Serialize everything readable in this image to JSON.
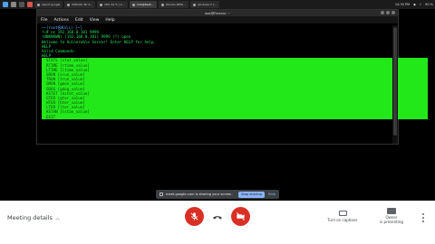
{
  "taskbar": {
    "menu_icon_color": "#4ea1ff",
    "tabs": [
      "",
      "",
      "",
      "",
      "report google",
      "Miktotik 3D A...",
      "CPU 34 % | 2...",
      "root@Kaali...",
      "Ubuntu MPTo...",
      "windows 7 [..."
    ],
    "status": [
      "14:30 PM",
      "",
      "",
      "90 %"
    ]
  },
  "terminal": {
    "title": "root@Freenix: ~",
    "menu": [
      "File",
      "Actions",
      "Edit",
      "View",
      "Help"
    ],
    "lines_before": [
      {
        "text": "──(root㉿Kali)-[~]",
        "blue": true
      },
      {
        "text": "└─# nc 192.168.0.101 9999",
        "blue": false
      },
      {
        "text": "(UNKNOWN) [192.168.0.101] 9999 (?) open",
        "blue": false
      },
      {
        "text": "Welcome to Vulnerable Server! Enter HELP for help.",
        "blue": false
      },
      {
        "text": "HELP",
        "blue": false
      },
      {
        "text": "Valid Commands:",
        "blue": false
      },
      {
        "text": "HELP",
        "blue": false
      }
    ],
    "highlighted": [
      "STATS [stat_value]",
      "RTIME [rtime_value]",
      "LTIME [ltime_value]",
      "SRUN [srun_value]",
      "TRUN [trun_value]",
      "GMON [gmon_value]",
      "GDOG [gdog_value]",
      "KSTET [kstet_value]",
      "GTER [gter_value]",
      "HTER [hter_value]",
      "LTER [lter_value]",
      "KSTAN [lstan_value]",
      "EXIT"
    ],
    "highlight_color": "#22e81a"
  },
  "notice": {
    "text": "meet.google.com is sharing your screen.",
    "stop_label": "Stop sharing",
    "hide_label": "Hide"
  },
  "meet": {
    "details_label": "Meeting details",
    "captions_label": "Turn on captions",
    "present_label_1": "Owner",
    "present_label_2": "is presenting",
    "danger_color": "#d93025"
  }
}
